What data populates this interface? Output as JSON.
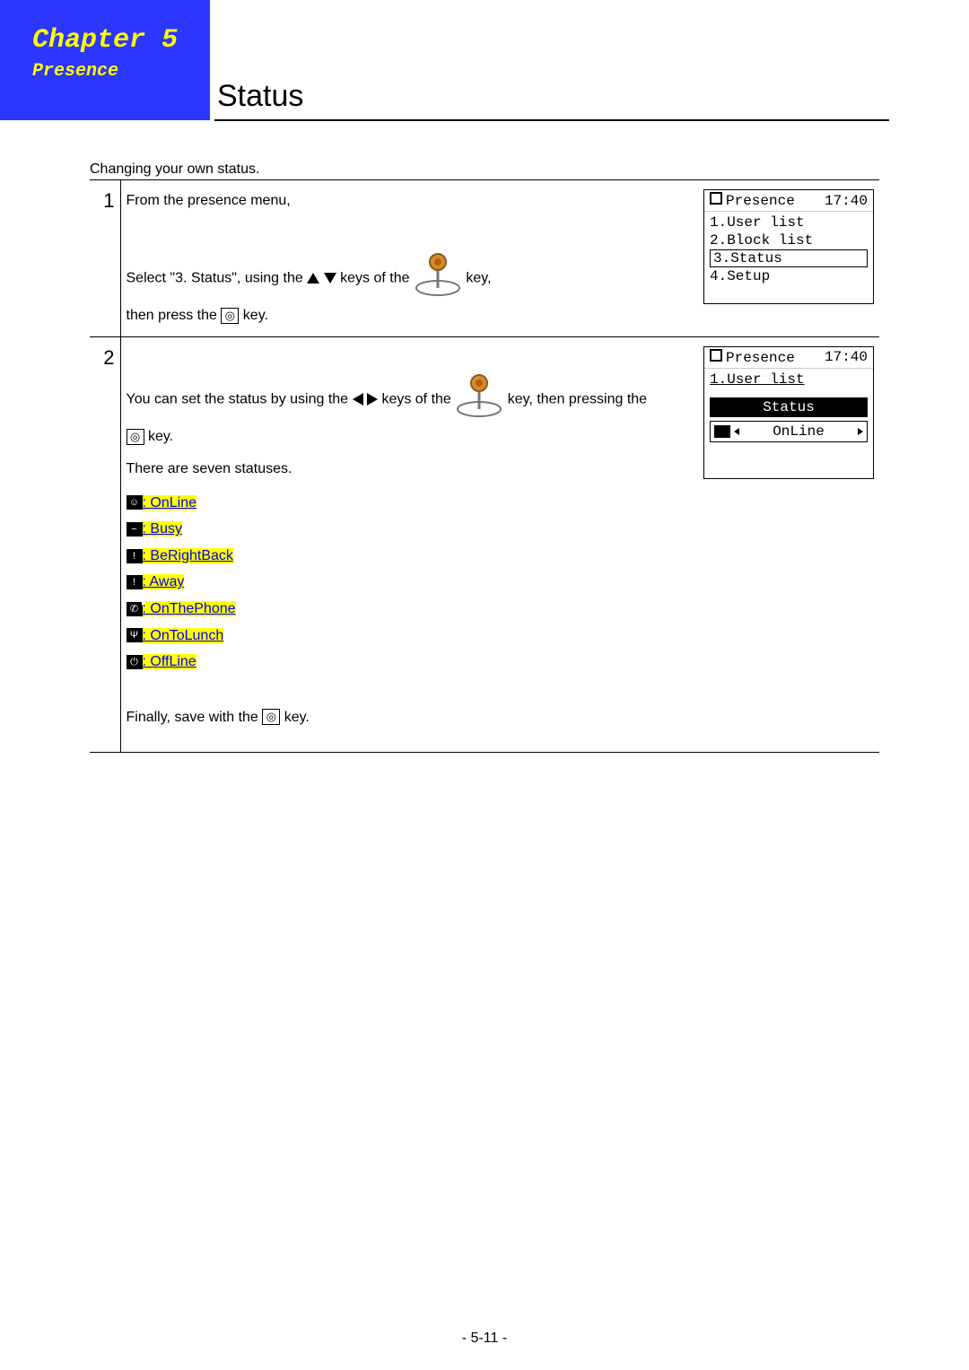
{
  "header": {
    "chapter": "Chapter 5",
    "subtitle": "Presence",
    "title": "Status"
  },
  "intro": "Changing your own status.",
  "steps": [
    {
      "num": "1",
      "line1_a": "From the presence menu,",
      "line2_a": "Select \"3. Status\", using the ",
      "line2_b": " keys of the ",
      "line2_c": " key,",
      "line3_a": "then press the ",
      "line3_b": " key.",
      "screen": {
        "title": "Presence",
        "time": "17:40",
        "items": [
          "1.User list",
          "2.Block list",
          "3.Status",
          "4.Setup"
        ],
        "selected_index": 2
      }
    },
    {
      "num": "2",
      "line1_a": "You can set the status by using the ",
      "line1_b": " keys of the ",
      "line1_c": " key, then pressing the ",
      "line2_a": " key.",
      "line3": "There are seven statuses.",
      "statuses": [
        ": OnLine",
        ": Busy",
        ": BeRightBack",
        ": Away",
        ": OnThePhone",
        ": OnToLunch",
        ": OffLine"
      ],
      "final_a": "Finally, save with the ",
      "final_b": "  key.",
      "screen": {
        "title": "Presence",
        "time": "17:40",
        "crumb": "1.User list",
        "status_label": "Status",
        "value": "OnLine"
      }
    }
  ],
  "footer": "- 5-11 -"
}
